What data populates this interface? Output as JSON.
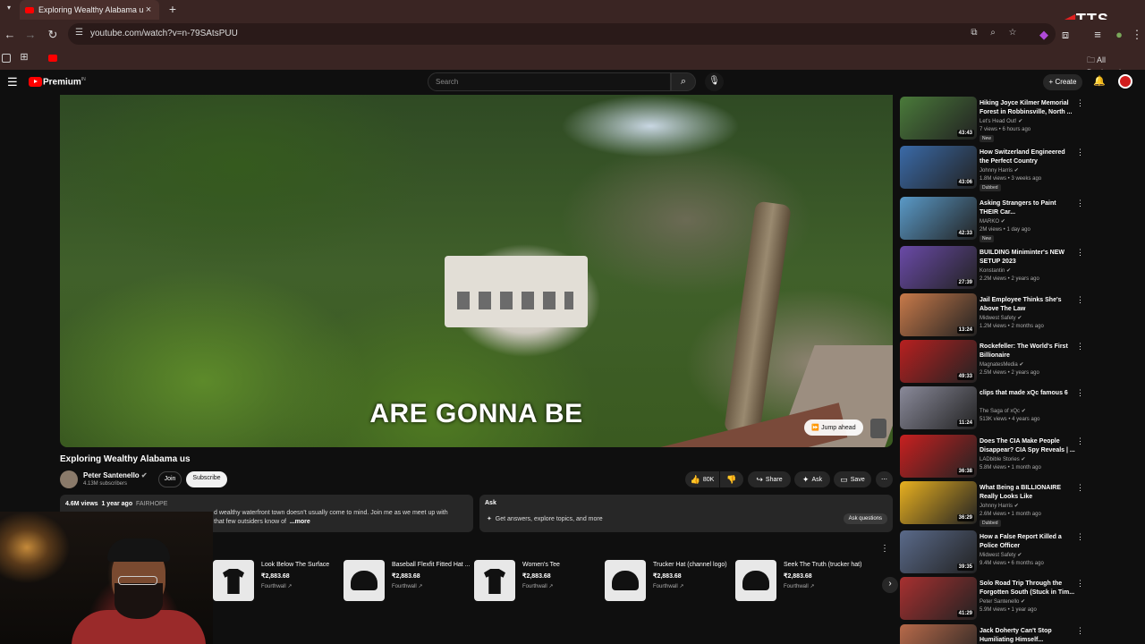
{
  "browser": {
    "tab_title": "Exploring Wealthy Alabama us",
    "url": "youtube.com/watch?v=n-79SAtsPUU",
    "bookmarks_label": "All Bookmarks",
    "overlay_logo": "TTS"
  },
  "youtube": {
    "logo_text": "Premium",
    "logo_super": "IN",
    "search_placeholder": "Search",
    "create_label": "Create"
  },
  "video": {
    "caption": "ARE GONNA BE",
    "jump_label": "Jump ahead",
    "title": "Exploring Wealthy Alabama us",
    "channel": "Peter Santenello",
    "subscribers": "4.13M subscribers",
    "join_label": "Join",
    "subscribe_label": "Subscribe",
    "likes": "80K",
    "share_label": "Share",
    "ask_label": "Ask",
    "save_label": "Save"
  },
  "description": {
    "views": "4.6M views",
    "age": "1 year ago",
    "tag": "FAIRHOPE",
    "line1": "d wealthy waterfront town doesn't usually come to mind. Join me as we meet up with",
    "line2": "that few outsiders know of",
    "more": "...more"
  },
  "ask_panel": {
    "title": "Ask",
    "subtitle": "Get answers, explore topics, and more",
    "button": "Ask questions"
  },
  "shop": [
    {
      "name": "Look Below The Surface",
      "price": "₹2,883.68",
      "vendor": "Fourthwall",
      "kind": "tee"
    },
    {
      "name": "Baseball Flexfit Fitted Hat ...",
      "price": "₹2,883.68",
      "vendor": "Fourthwall",
      "kind": "cap"
    },
    {
      "name": "Women's Tee",
      "price": "₹2,883.68",
      "vendor": "Fourthwall",
      "kind": "tee"
    },
    {
      "name": "Trucker Hat (channel logo)",
      "price": "₹2,883.68",
      "vendor": "Fourthwall",
      "kind": "cap"
    },
    {
      "name": "Seek The Truth (trucker hat)",
      "price": "₹2,883.68",
      "vendor": "Fourthwall",
      "kind": "cap"
    }
  ],
  "recommendations": [
    {
      "title": "Hiking Joyce Kilmer Memorial Forest in Robbinsville, North ...",
      "channel": "Let's Head Out!",
      "meta": "7 views • 6 hours ago",
      "badge": "New",
      "duration": "43:43",
      "color": "#4a7a3a"
    },
    {
      "title": "How Switzerland Engineered the Perfect Country",
      "channel": "Johnny Harris",
      "meta": "1.8M views • 3 weeks ago",
      "badge": "Dubbed",
      "duration": "43:06",
      "color": "#3a6aa8"
    },
    {
      "title": "Asking Strangers to Paint THEIR Car...",
      "channel": "MARKO",
      "meta": "2M views • 1 day ago",
      "badge": "New",
      "duration": "42:33",
      "color": "#5a9ac8"
    },
    {
      "title": "BUILDING Miniminter's NEW SETUP 2023",
      "channel": "Konstantin",
      "meta": "2.2M views • 2 years ago",
      "badge": "",
      "duration": "27:39",
      "color": "#6a4aa8"
    },
    {
      "title": "Jail Employee Thinks She's Above The Law",
      "channel": "Midwest Safety",
      "meta": "1.2M views • 2 months ago",
      "badge": "",
      "duration": "13:24",
      "color": "#c87a4a"
    },
    {
      "title": "Rockefeller: The World's First Billionaire",
      "channel": "MagnatesMedia",
      "meta": "2.5M views • 2 years ago",
      "badge": "",
      "duration": "49:33",
      "color": "#b82020"
    },
    {
      "title": "clips that made xQc famous 6",
      "channel": "The Saga of xQc",
      "meta": "513K views • 4 years ago",
      "badge": "",
      "duration": "11:24",
      "color": "#8a8a9a"
    },
    {
      "title": "Does The CIA Make People Disappear? CIA Spy Reveals | ...",
      "channel": "LADbible Stories",
      "meta": "5.8M views • 1 month ago",
      "badge": "",
      "duration": "36:38",
      "color": "#c82020"
    },
    {
      "title": "What Being a BILLIONAIRE Really Looks Like",
      "channel": "Johnny Harris",
      "meta": "2.6M views • 1 month ago",
      "badge": "Dubbed",
      "duration": "36:29",
      "color": "#e8b020"
    },
    {
      "title": "How a False Report Killed a Police Officer",
      "channel": "Midwest Safety",
      "meta": "9.4M views • 6 months ago",
      "badge": "",
      "duration": "39:35",
      "color": "#5a6a8a"
    },
    {
      "title": "Solo Road Trip Through the Forgotten South (Stuck in Tim...",
      "channel": "Peter Santenello",
      "meta": "5.9M views • 1 year ago",
      "badge": "",
      "duration": "41:29",
      "color": "#a83030"
    },
    {
      "title": "Jack Doherty Can't Stop Humiliating Himself...",
      "channel": "",
      "meta": "",
      "badge": "",
      "duration": "",
      "color": "#b86a4a"
    }
  ]
}
